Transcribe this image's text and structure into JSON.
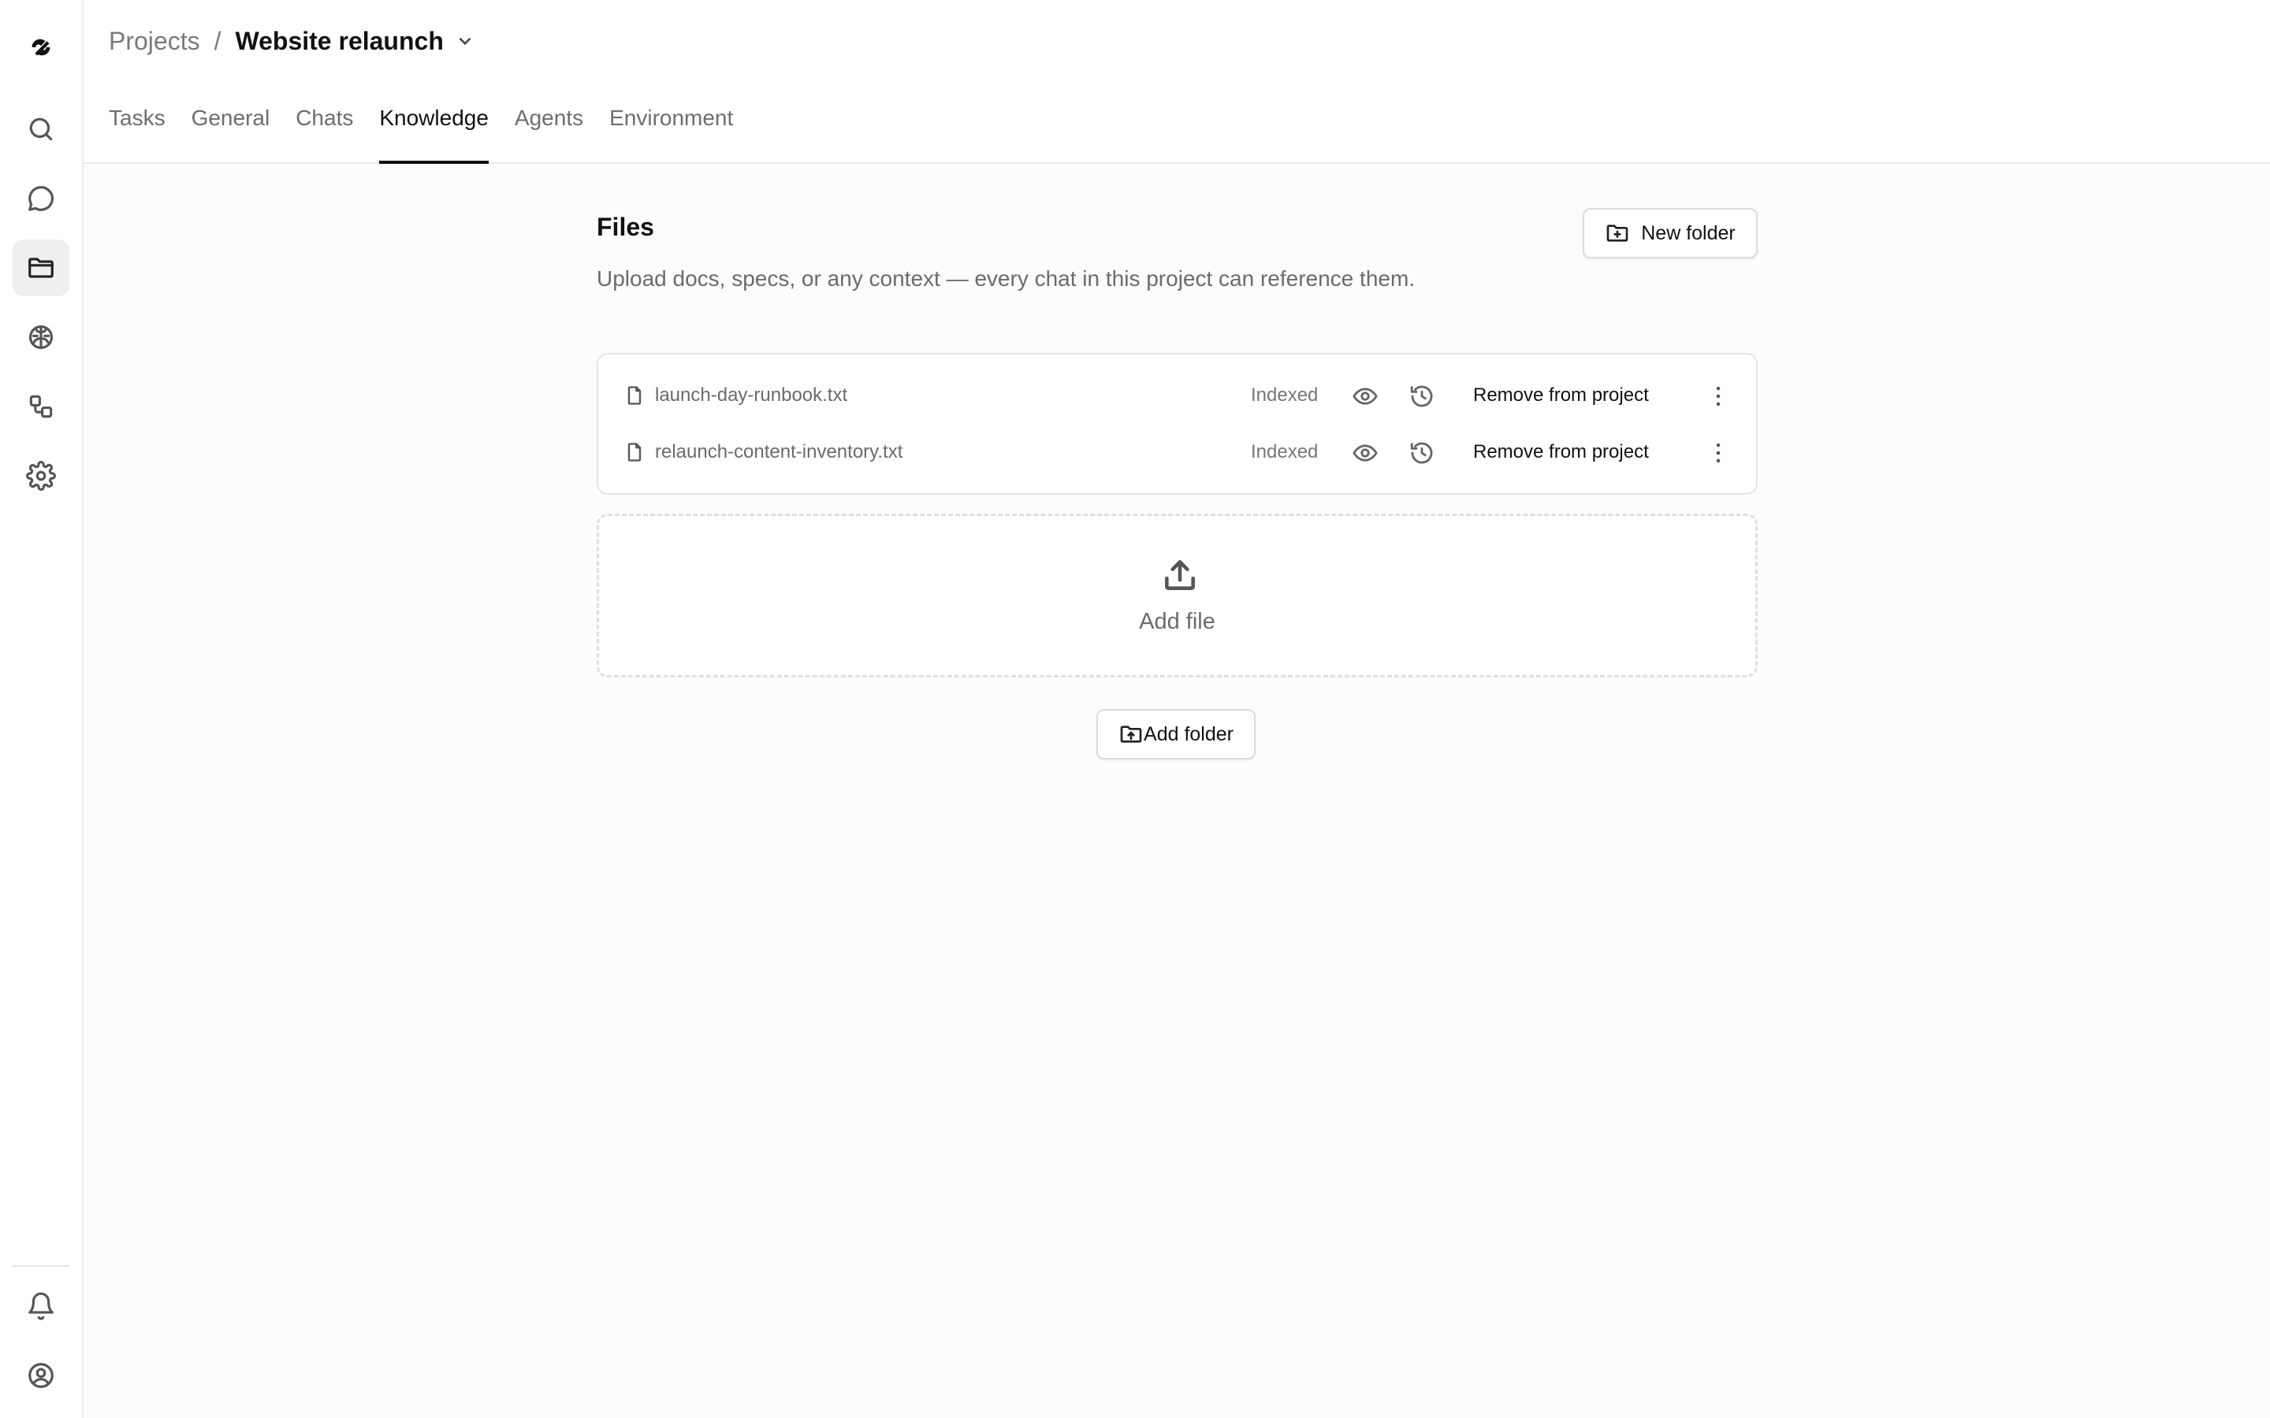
{
  "sidebar": {
    "items": [
      {
        "icon": "logo-icon"
      },
      {
        "icon": "search-icon"
      },
      {
        "icon": "chat-icon"
      },
      {
        "icon": "folder-icon",
        "active": true
      },
      {
        "icon": "brain-icon"
      },
      {
        "icon": "workflow-icon"
      },
      {
        "icon": "gear-icon"
      },
      {
        "icon": "bell-icon"
      },
      {
        "icon": "user-circle-icon"
      }
    ]
  },
  "header": {
    "breadcrumb_root": "Projects",
    "breadcrumb_sep": "/",
    "project_name": "Website relaunch"
  },
  "tabs": [
    {
      "label": "Tasks"
    },
    {
      "label": "General"
    },
    {
      "label": "Chats"
    },
    {
      "label": "Knowledge",
      "active": true
    },
    {
      "label": "Agents"
    },
    {
      "label": "Environment"
    }
  ],
  "files": {
    "title": "Files",
    "description": "Upload docs, specs, or any context — every chat in this project can reference them.",
    "new_folder_label": "New folder",
    "list": [
      {
        "name": "launch-day-runbook.txt",
        "status": "Indexed",
        "remove_label": "Remove from project"
      },
      {
        "name": "relaunch-content-inventory.txt",
        "status": "Indexed",
        "remove_label": "Remove from project"
      }
    ],
    "add_file_label": "Add file",
    "add_folder_label": "Add folder"
  },
  "colors": {
    "accent": "#111111",
    "muted_text": "#6b6b6b",
    "border": "#e4e4e4",
    "background": "#fcfcfc"
  }
}
